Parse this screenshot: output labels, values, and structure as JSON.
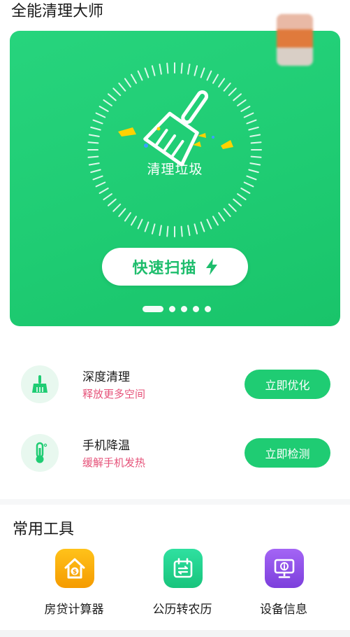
{
  "header": {
    "app_title": "全能清理大师"
  },
  "hero": {
    "label": "清理垃圾",
    "scan_button_label": "快速扫描",
    "page_count": 5,
    "active_page": 1,
    "colors": {
      "background": "#1fcc73",
      "button_text": "#1dbd6c"
    }
  },
  "features": [
    {
      "title": "深度清理",
      "subtitle": "释放更多空间",
      "action": "立即优化",
      "icon": "broom-icon"
    },
    {
      "title": "手机降温",
      "subtitle": "缓解手机发热",
      "action": "立即检测",
      "icon": "thermometer-icon"
    }
  ],
  "tools": {
    "title": "常用工具",
    "items": [
      {
        "label": "房贷计算器",
        "icon": "house-money-icon",
        "color": "#f5a000"
      },
      {
        "label": "公历转农历",
        "icon": "calendar-convert-icon",
        "color": "#1fcc8a"
      },
      {
        "label": "设备信息",
        "icon": "monitor-info-icon",
        "color": "#8a4fe0"
      }
    ]
  },
  "colors": {
    "accent": "#1fcc73",
    "subtitle": "#e6537a"
  }
}
